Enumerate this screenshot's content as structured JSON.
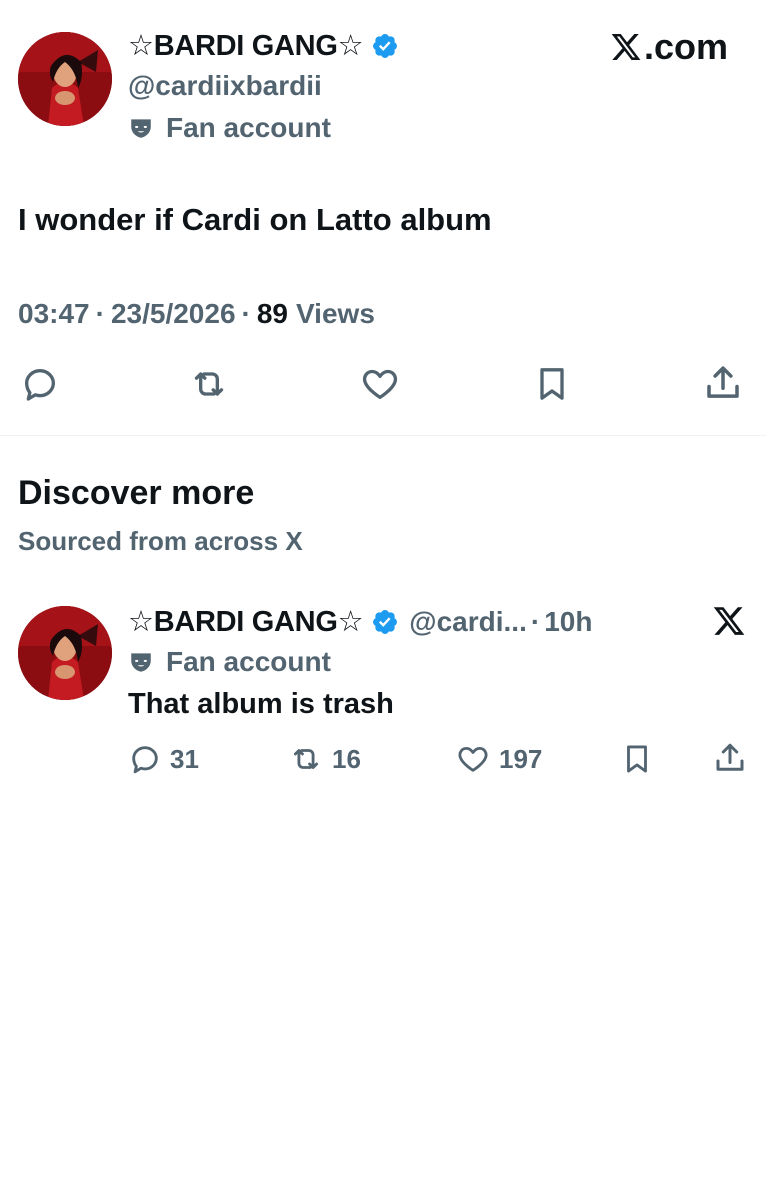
{
  "brand": {
    "label": ".com",
    "icon": "x-logo-icon"
  },
  "main_tweet": {
    "display_name": "☆BARDI GANG☆",
    "handle": "@cardiixbardii",
    "badge": "Fan account",
    "text": "I wonder if Cardi on Latto album",
    "time": "03:47",
    "date": "23/5/2026",
    "views_count": "89",
    "views_label": "Views",
    "actions": [
      "reply-icon",
      "retweet-icon",
      "like-icon",
      "bookmark-icon",
      "share-icon"
    ]
  },
  "discover": {
    "title": "Discover more",
    "subtitle": "Sourced from across X"
  },
  "related_tweet": {
    "display_name": "☆BARDI GANG☆",
    "handle": "@cardi...",
    "time": "10h",
    "badge": "Fan account",
    "text": "That album is trash",
    "replies": "31",
    "retweets": "16",
    "likes": "197"
  },
  "colors": {
    "text_primary": "#0f1419",
    "text_secondary": "#536471",
    "verified_blue": "#1d9bf0",
    "divider": "#eff3f4"
  }
}
